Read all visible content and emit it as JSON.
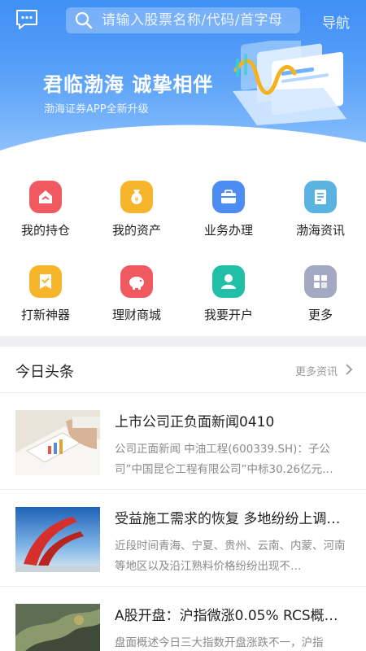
{
  "header": {
    "search_placeholder": "请输入股票名称/代码/首字母",
    "nav_label": "导航"
  },
  "banner": {
    "title": "君临渤海  诚挚相伴",
    "subtitle": "渤海证券APP全新升级"
  },
  "grid": {
    "items": [
      {
        "label": "我的持仓",
        "icon": "holdings-icon",
        "color": "#ee5a5f"
      },
      {
        "label": "我的资产",
        "icon": "assets-icon",
        "color": "#f7b52b"
      },
      {
        "label": "业务办理",
        "icon": "business-icon",
        "color": "#4d8df2"
      },
      {
        "label": "渤海资讯",
        "icon": "news-icon",
        "color": "#5bb3e1"
      },
      {
        "label": "打新神器",
        "icon": "ipo-icon",
        "color": "#f7b52b"
      },
      {
        "label": "理财商城",
        "icon": "wealth-shop-icon",
        "color": "#ee5a5f"
      },
      {
        "label": "我要开户",
        "icon": "open-account-icon",
        "color": "#21bfa7"
      },
      {
        "label": "更多",
        "icon": "more-grid-icon",
        "color": "#a3a8c3"
      }
    ]
  },
  "news": {
    "section_title": "今日头条",
    "more_label": "更多资讯",
    "items": [
      {
        "title": "上市公司正负面新闻0410",
        "summary": "公司正面新闻 中油工程(600339.SH)：子公司”中国昆仑工程有限公司”中标30.26亿元…"
      },
      {
        "title": "受益施工需求的恢复 多地纷纷上调…",
        "summary": "近段时间青海、宁夏、贵州、云南、内蒙、河南等地区以及沿江熟料价格纷纷出现不…"
      },
      {
        "title": "A股开盘：沪指微涨0.05% RCS概…",
        "summary": "盘面概述今日三大指数开盘涨跌不一，沪指"
      }
    ]
  },
  "colors": {
    "banner_blue": "#3f8ff5",
    "separator": "#efeff1"
  }
}
